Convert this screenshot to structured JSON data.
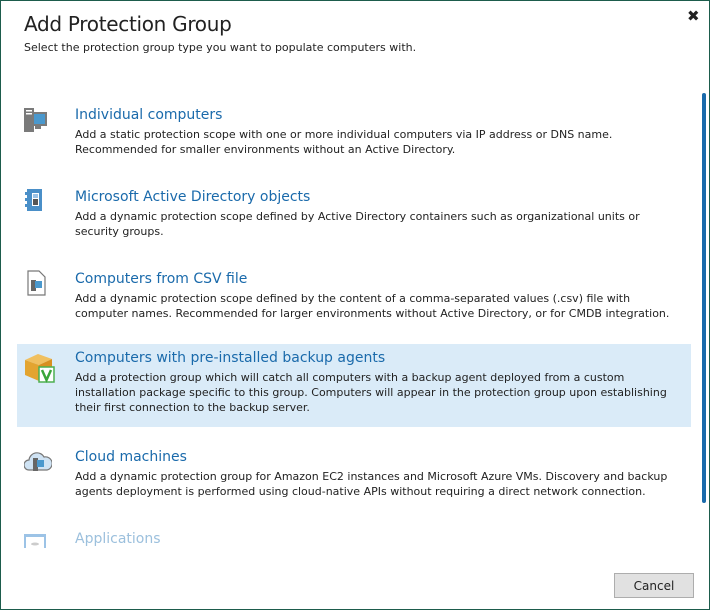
{
  "dialog": {
    "title": "Add Protection Group",
    "subtitle": "Select the protection group type you want to populate computers with.",
    "close_icon": "close-icon"
  },
  "items": [
    {
      "title": "Individual computers",
      "description": "Add a static protection scope with one or more individual computers via IP address or DNS name. Recommended for smaller environments without an Active Directory.",
      "icon": "computer-icon"
    },
    {
      "title": "Microsoft Active Directory objects",
      "description": "Add a dynamic protection scope defined by Active Directory containers such as organizational units or security groups.",
      "icon": "active-directory-icon"
    },
    {
      "title": "Computers from CSV file",
      "description": "Add a dynamic protection scope defined by the content of a comma-separated values (.csv) file with computer names. Recommended for larger environments without Active Directory, or for CMDB integration.",
      "icon": "csv-file-icon"
    },
    {
      "title": "Computers with pre-installed backup agents",
      "description": "Add a protection group which will catch all computers with a backup agent deployed from a custom installation package specific to this group. Computers will appear in the protection group upon establishing their first connection to the backup server.",
      "icon": "package-icon",
      "selected": true
    },
    {
      "title": "Cloud machines",
      "description": "Add a dynamic protection group for Amazon EC2 instances and Microsoft Azure VMs. Discovery and backup agents deployment is performed using cloud-native APIs without requiring a direct network connection.",
      "icon": "cloud-icon"
    },
    {
      "title": "Applications",
      "icon": "application-icon",
      "disabled": true
    }
  ],
  "footer": {
    "cancel_label": "Cancel"
  },
  "colors": {
    "accent": "#1a6aab",
    "selected_bg": "#daebf8",
    "border": "#1d5c4c"
  }
}
